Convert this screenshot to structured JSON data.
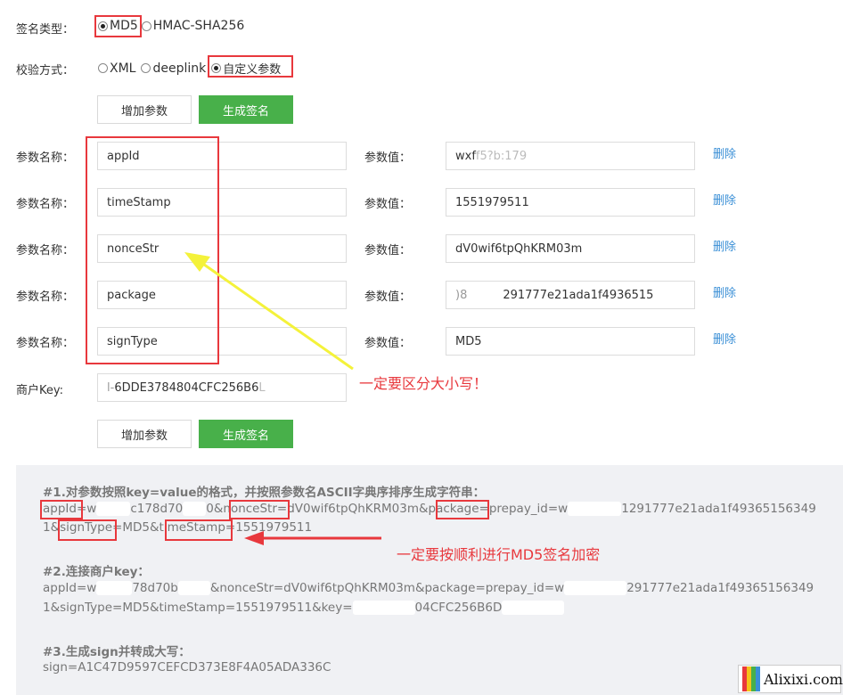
{
  "sign_type": {
    "label": "签名类型：",
    "options": [
      "MD5",
      "HMAC-SHA256"
    ],
    "selected": "MD5"
  },
  "verify_method": {
    "label": "校验方式：",
    "options": [
      "XML",
      "deeplink",
      "自定义参数"
    ],
    "selected": "自定义参数"
  },
  "buttons": {
    "add_param": "增加参数",
    "generate_sign": "生成签名"
  },
  "params": {
    "name_label": "参数名称：",
    "value_label": "参数值：",
    "delete_label": "删除",
    "rows": [
      {
        "name": "appId",
        "value": "wxf"
      },
      {
        "name": "timeStamp",
        "value": "1551979511"
      },
      {
        "name": "nonceStr",
        "value": "dV0wif6tpQhKRM03m"
      },
      {
        "name": "package",
        "value": "291777e21ada1f4936515"
      },
      {
        "name": "signType",
        "value": "MD5"
      }
    ]
  },
  "merchant_key": {
    "label": "商户Key:",
    "value": "6DDE3784804CFC256B6"
  },
  "annotations": {
    "case_sensitive": "一定要区分大小写！",
    "md5_order": "一定要按顺利进行MD5签名加密"
  },
  "result": {
    "step1_title": "#1.对参数按照key=value的格式，并按照参数名ASCII字典序排序生成字符串：",
    "step1_line1_a": "appId",
    "step1_line1_b": "=w",
    "step1_line1_c": "c178d70",
    "step1_line1_d": "0&",
    "step1_line1_e": "nonceStr",
    "step1_line1_f": "=dV0wif6tpQhKRM03m&",
    "step1_line1_g": "package",
    "step1_line1_h": "=prepay_id=w",
    "step1_line1_i": "1291777e21ada1f49365156349",
    "step1_line2_a": "1&",
    "step1_line2_b": "signType",
    "step1_line2_c": "=MD5&",
    "step1_line2_d": "timeStamp",
    "step1_line2_e": "=1551979511",
    "step2_title": "#2.连接商户key：",
    "step2_line1_a": "appId=w",
    "step2_line1_b": "78d70b",
    "step2_line1_c": "&nonceStr=dV0wif6tpQhKRM03m&package=prepay_id=w",
    "step2_line1_d": "291777e21ada1f49365156349",
    "step2_line2_a": "1&signType=MD5&timeStamp=1551979511&key=",
    "step2_line2_b": "04CFC256B6D",
    "step3_title": "#3.生成sign并转成大写：",
    "step3_value": "sign=A1C47D9597CEFCD373E8F4A05ADA336C"
  },
  "watermark": {
    "text": "Alixixi.com"
  },
  "colors": {
    "primary_button": "#48b04a",
    "annotation_red": "#e8383d",
    "link_blue": "#3a8fd6",
    "arrow_yellow": "#f4f23a",
    "panel_bg": "#f0f1f4"
  }
}
